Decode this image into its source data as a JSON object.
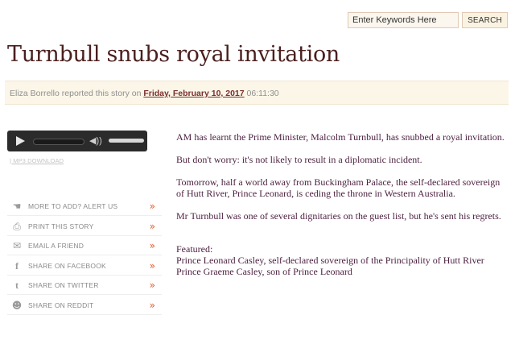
{
  "search": {
    "placeholder": "Enter Keywords Here",
    "button_label": "SEARCH"
  },
  "story": {
    "headline": "Turnbull snubs royal invitation",
    "byline": {
      "author": "Eliza Borrello",
      "reported_text": " reported this story on ",
      "date": "Friday, February 10, 2017",
      "time": " 06:11:30"
    },
    "paragraphs": [
      "AM has learnt the Prime Minister, Malcolm Turnbull, has snubbed a royal invitation.",
      "But don't worry: it's not likely to result in a diplomatic incident.",
      "Tomorrow, half a world away from Buckingham Palace, the self-declared sovereign of Hutt River, Prince Leonard, is ceding the throne in Western Australia.",
      "Mr Turnbull was one of several dignitaries on the guest list, but he's sent his regrets."
    ],
    "featured": {
      "label": "Featured:",
      "people": [
        "Prince Leonard Casley, self-declared sovereign of the Principality of Hutt River",
        "Prince Graeme Casley, son of Prince Leonard"
      ]
    }
  },
  "audio": {
    "mp3_link": "| MP3 DOWNLOAD",
    "volume_glyph": "◀))"
  },
  "share": {
    "arrow": "»",
    "items": [
      {
        "label": "MORE TO ADD? ALERT US",
        "icon": "pointing-hand-icon",
        "glyph": "☚"
      },
      {
        "label": "PRINT THIS STORY",
        "icon": "printer-icon",
        "glyph": "⎙"
      },
      {
        "label": "EMAIL A FRIEND",
        "icon": "envelope-icon",
        "glyph": "✉"
      },
      {
        "label": "SHARE ON FACEBOOK",
        "icon": "facebook-icon",
        "glyph": "f"
      },
      {
        "label": "SHARE ON TWITTER",
        "icon": "twitter-icon",
        "glyph": "t"
      },
      {
        "label": "SHARE ON REDDIT",
        "icon": "reddit-icon",
        "glyph": "☻"
      }
    ]
  }
}
